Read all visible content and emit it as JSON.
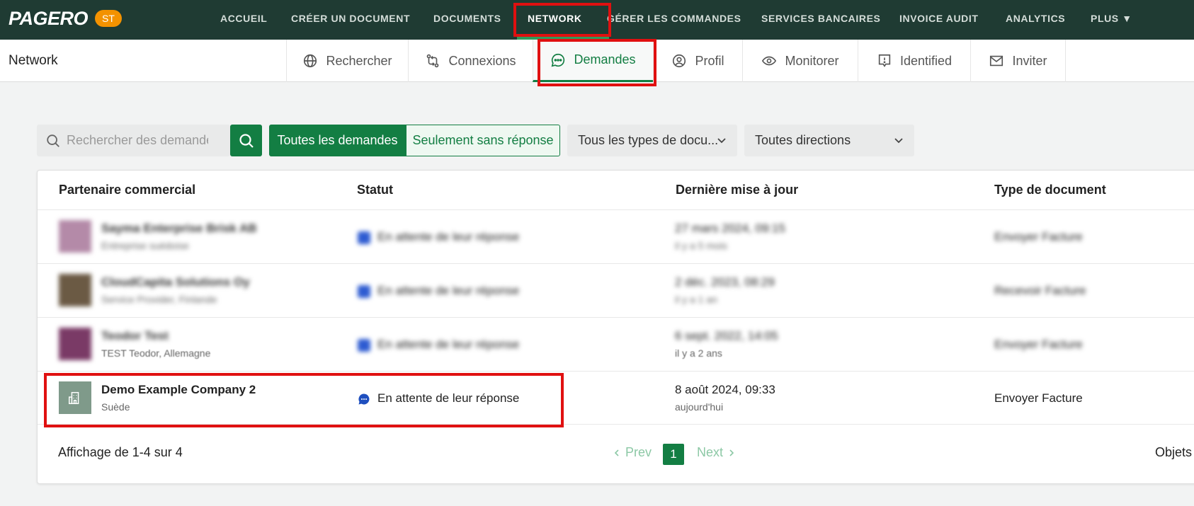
{
  "brand": {
    "logo": "PAGERO",
    "badge": "ST",
    "badge_color": "#f39200",
    "nav_bg": "#1f3b33",
    "accent": "#137e43"
  },
  "topnav": {
    "items": [
      "ACCUEIL",
      "CRÉER UN DOCUMENT",
      "DOCUMENTS",
      "NETWORK",
      "GÉRER LES COMMANDES",
      "SERVICES BANCAIRES",
      "INVOICE AUDIT",
      "ANALYTICS",
      "PLUS ▼"
    ],
    "active": "NETWORK"
  },
  "subnav": {
    "title": "Network",
    "tabs": [
      {
        "label": "Rechercher",
        "icon": "globe-icon"
      },
      {
        "label": "Connexions",
        "icon": "connections-icon"
      },
      {
        "label": "Demandes",
        "icon": "chat-icon",
        "active": true
      },
      {
        "label": "Profil",
        "icon": "user-circle-icon"
      },
      {
        "label": "Monitorer",
        "icon": "eye-icon"
      },
      {
        "label": "Identified",
        "icon": "alert-icon"
      },
      {
        "label": "Inviter",
        "icon": "mail-icon"
      }
    ]
  },
  "filters": {
    "search_placeholder": "Rechercher des demandes",
    "toggle_all": "Toutes les demandes",
    "toggle_unanswered": "Seulement sans réponse",
    "doc_types": "Tous les types de docu...",
    "directions": "Toutes directions"
  },
  "table": {
    "columns": [
      "Partenaire commercial",
      "Statut",
      "Dernière mise à jour",
      "Type de document"
    ],
    "rows": [
      {
        "name": "Sayma Enterprise Brisk AB",
        "sub": "Entreprise suédoise",
        "status": "En attente de leur réponse",
        "date": "27 mars 2024, 09:15",
        "ago": "il y a 5 mois",
        "type": "Envoyer Facture",
        "avatar_color": "#b48aa8",
        "blurred": true
      },
      {
        "name": "CloudCapita Solutions Oy",
        "sub": "Service Provider, Finlande",
        "status": "En attente de leur réponse",
        "date": "2 déc. 2023, 08:29",
        "ago": "il y a 1 an",
        "type": "Recevoir Facture",
        "avatar_color": "#6b5a44",
        "blurred": true
      },
      {
        "name": "Teodor Test",
        "sub": "TEST Teodor, Allemagne",
        "status": "En attente de leur réponse",
        "date": "6 sept. 2022, 14:05",
        "ago": "il y a 2 ans",
        "type": "Envoyer Facture",
        "avatar_color": "#7a3a66",
        "blurred": true
      },
      {
        "name": "Demo Example Company 2",
        "sub": "Suède",
        "status": "En attente de leur réponse",
        "date": "8 août 2024, 09:33",
        "ago": "aujourd'hui",
        "type": "Envoyer Facture",
        "avatar_color": "#7f9a8a",
        "blurred": false
      }
    ]
  },
  "footer": {
    "showing": "Affichage de 1-4 sur 4",
    "prev": "Prev",
    "page": "1",
    "next": "Next",
    "per_page": "Objets p"
  }
}
